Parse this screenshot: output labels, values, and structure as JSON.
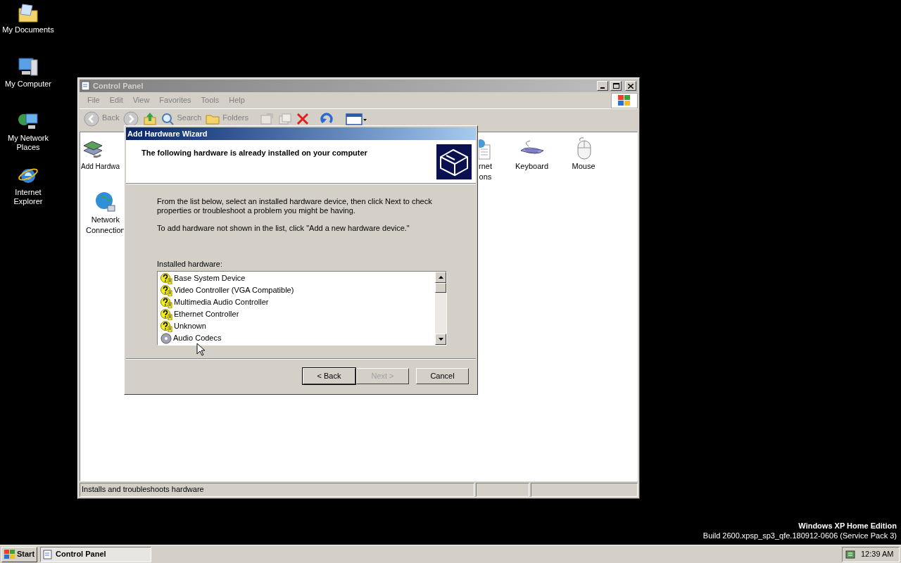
{
  "desktop": {
    "icons": [
      {
        "kind": "documents",
        "label": "My Documents"
      },
      {
        "kind": "computer",
        "label": "My Computer"
      },
      {
        "kind": "network",
        "label": "My Network Places"
      },
      {
        "kind": "ie",
        "label": "Internet Explorer"
      }
    ],
    "edition": "Windows XP Home Edition",
    "build": "Build 2600.xpsp_sp3_qfe.180912-0606 (Service Pack 3)"
  },
  "control_panel": {
    "title": "Control Panel",
    "menu": [
      "File",
      "Edit",
      "View",
      "Favorites",
      "Tools",
      "Help"
    ],
    "toolbar": [
      {
        "kind": "back",
        "label": "Back"
      },
      {
        "kind": "forward"
      },
      {
        "kind": "up"
      },
      {
        "kind": "search",
        "label": "Search"
      },
      {
        "kind": "folders",
        "label": "Folders"
      },
      {
        "kind": "move"
      },
      {
        "kind": "copy"
      },
      {
        "kind": "delete"
      },
      {
        "kind": "undo"
      },
      {
        "kind": "views"
      }
    ],
    "items": [
      {
        "kind": "hardware",
        "lines": [
          "Add Hardwa"
        ]
      },
      {
        "kind": "network",
        "lines": [
          "Network",
          "Connection"
        ]
      },
      {
        "kind": "internet",
        "lines": [
          "rnet",
          "ons"
        ]
      },
      {
        "kind": "keyboard",
        "lines": [
          "Keyboard"
        ]
      },
      {
        "kind": "mouse",
        "lines": [
          "Mouse"
        ]
      }
    ],
    "status": "Installs and troubleshoots hardware"
  },
  "wizard": {
    "title": "Add Hardware Wizard",
    "heading": "The following hardware is already installed on your computer",
    "paragraphs": [
      "From the list below, select an installed hardware device, then click Next to check properties or troubleshoot a problem you might be having.",
      "To add hardware not shown in the list, click \"Add a new hardware device.\""
    ],
    "list_label": "Installed hardware:",
    "devices": [
      {
        "kind": "unknown",
        "name": "Base System Device"
      },
      {
        "kind": "unknown",
        "name": "Video Controller (VGA Compatible)"
      },
      {
        "kind": "unknown",
        "name": "Multimedia Audio Controller"
      },
      {
        "kind": "unknown",
        "name": "Ethernet Controller"
      },
      {
        "kind": "unknown",
        "name": "Unknown"
      },
      {
        "kind": "codec",
        "name": "Audio Codecs"
      }
    ],
    "buttons": [
      {
        "label": "< Back",
        "disabled": false,
        "default": true
      },
      {
        "label": "Next >",
        "disabled": true,
        "default": false
      },
      {
        "label": "Cancel",
        "disabled": false,
        "default": false
      }
    ]
  },
  "taskbar": {
    "start": "Start",
    "tasks": [
      {
        "label": "Control Panel",
        "selected": true
      }
    ],
    "clock": "12:39 AM"
  }
}
